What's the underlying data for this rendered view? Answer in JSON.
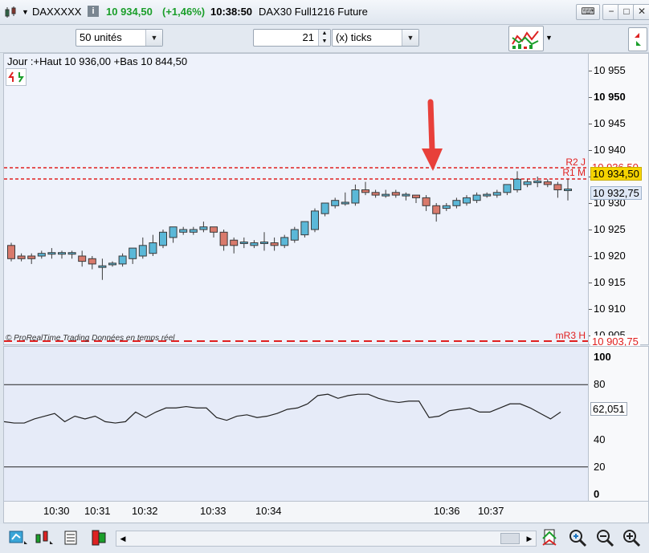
{
  "titlebar": {
    "instrument": "DAXXXXX",
    "price": "10 934,50",
    "change": "(+1,46%)",
    "time": "10:38:50",
    "description": "DAX30 Full1216 Future",
    "info_icon": "info-icon"
  },
  "toolbar": {
    "units_value": "50 unités",
    "ticks_value": "21",
    "ticks_unit": "(x) ticks"
  },
  "chart": {
    "header": "Jour :+Haut 10 936,00 +Bas 10 844,50",
    "watermark": "© ProRealTime Trading  Données en temps réel",
    "price_ticks": [
      "10 955",
      "10 950",
      "10 945",
      "10 940",
      "10 935",
      "10 930",
      "10 925",
      "10 920",
      "10 915",
      "10 910",
      "10 905"
    ],
    "levels": [
      {
        "label": "R2 J",
        "value": "10 936,50",
        "color": "#e0201f"
      },
      {
        "label": "R1 M",
        "value": "10 934,50",
        "color": "#e0201f"
      },
      {
        "label": "mR3 H",
        "value": "10 903,75",
        "color": "#e0201f"
      }
    ],
    "last_price": "10 934,50",
    "other_price": "10 932,75",
    "indicator_value": "62,051",
    "indicator_ticks": [
      "100",
      "80",
      "60",
      "40",
      "20",
      "0"
    ],
    "time_labels": [
      "10:30",
      "10:31",
      "10:32",
      "10:33",
      "10:34",
      "10:36",
      "10:37"
    ]
  },
  "chart_data": {
    "type": "candlestick",
    "ylim": [
      10902,
      10959
    ],
    "candles": [
      [
        10922.0,
        10919.5,
        10922.5,
        10919.0
      ],
      [
        10920.0,
        10919.5,
        10920.5,
        10919.0
      ],
      [
        10920.0,
        10919.5,
        10920.5,
        10918.5
      ],
      [
        10920.0,
        10920.5,
        10921.0,
        10919.5
      ],
      [
        10920.5,
        10920.5,
        10921.5,
        10919.5
      ],
      [
        10920.5,
        10920.5,
        10921.0,
        10919.5
      ],
      [
        10920.5,
        10920.5,
        10921.0,
        10919.5
      ],
      [
        10920.0,
        10919.0,
        10921.0,
        10918.0
      ],
      [
        10919.5,
        10918.5,
        10920.0,
        10917.5
      ],
      [
        10918.0,
        10918.0,
        10919.5,
        10915.5
      ],
      [
        10918.5,
        10918.5,
        10919.0,
        10918.0
      ],
      [
        10918.5,
        10920.0,
        10920.5,
        10918.0
      ],
      [
        10919.5,
        10921.5,
        10921.5,
        10918.5
      ],
      [
        10920.0,
        10922.0,
        10923.5,
        10919.5
      ],
      [
        10920.5,
        10922.5,
        10924.0,
        10920.0
      ],
      [
        10922.0,
        10924.5,
        10925.0,
        10921.5
      ],
      [
        10923.5,
        10925.5,
        10925.5,
        10922.5
      ],
      [
        10924.5,
        10925.0,
        10925.5,
        10924.0
      ],
      [
        10924.5,
        10925.0,
        10925.5,
        10924.0
      ],
      [
        10925.0,
        10925.5,
        10926.5,
        10924.5
      ],
      [
        10925.5,
        10924.5,
        10925.5,
        10923.5
      ],
      [
        10924.5,
        10922.0,
        10925.0,
        10921.0
      ],
      [
        10923.0,
        10922.0,
        10923.5,
        10920.5
      ],
      [
        10922.5,
        10922.5,
        10923.5,
        10921.5
      ],
      [
        10922.0,
        10922.5,
        10923.0,
        10921.5
      ],
      [
        10922.5,
        10922.5,
        10924.5,
        10921.0
      ],
      [
        10922.5,
        10922.0,
        10923.5,
        10921.0
      ],
      [
        10922.0,
        10923.5,
        10924.0,
        10921.5
      ],
      [
        10923.0,
        10925.0,
        10925.5,
        10922.5
      ],
      [
        10924.0,
        10926.5,
        10926.5,
        10923.5
      ],
      [
        10925.0,
        10928.5,
        10929.0,
        10924.5
      ],
      [
        10928.0,
        10930.0,
        10930.0,
        10927.5
      ],
      [
        10929.5,
        10930.5,
        10931.0,
        10929.0
      ],
      [
        10930.0,
        10930.0,
        10932.0,
        10929.5
      ],
      [
        10930.0,
        10932.5,
        10933.5,
        10929.5
      ],
      [
        10932.5,
        10932.0,
        10934.0,
        10931.5
      ],
      [
        10932.0,
        10931.5,
        10932.5,
        10931.0
      ],
      [
        10931.5,
        10931.5,
        10932.5,
        10931.0
      ],
      [
        10932.0,
        10931.5,
        10932.5,
        10931.0
      ],
      [
        10931.5,
        10931.5,
        10932.0,
        10930.5
      ],
      [
        10931.5,
        10931.0,
        10931.5,
        10930.0
      ],
      [
        10931.0,
        10929.5,
        10931.5,
        10928.5
      ],
      [
        10929.5,
        10928.0,
        10930.0,
        10926.5
      ],
      [
        10929.0,
        10929.5,
        10930.0,
        10928.5
      ],
      [
        10929.5,
        10930.5,
        10931.0,
        10929.0
      ],
      [
        10930.0,
        10931.0,
        10931.5,
        10929.5
      ],
      [
        10930.5,
        10931.5,
        10932.0,
        10930.0
      ],
      [
        10931.5,
        10931.5,
        10932.0,
        10931.0
      ],
      [
        10931.5,
        10932.0,
        10932.5,
        10931.0
      ],
      [
        10932.0,
        10933.5,
        10933.5,
        10931.5
      ],
      [
        10932.5,
        10934.5,
        10936.0,
        10932.0
      ],
      [
        10933.5,
        10934.0,
        10934.5,
        10933.0
      ],
      [
        10934.0,
        10934.0,
        10935.0,
        10933.0
      ],
      [
        10934.0,
        10933.5,
        10934.5,
        10933.0
      ],
      [
        10933.5,
        10932.5,
        10934.0,
        10931.0
      ],
      [
        10932.5,
        10932.5,
        10934.5,
        10930.5
      ]
    ],
    "indicator": [
      53,
      52,
      52,
      55,
      57,
      59,
      53,
      57,
      55,
      57,
      53,
      52,
      53,
      60,
      56,
      60,
      63,
      63,
      64,
      63,
      63,
      56,
      54,
      57,
      58,
      56,
      57,
      59,
      62,
      63,
      66,
      72,
      73,
      70,
      72,
      73,
      73,
      70,
      68,
      67,
      68,
      68,
      56,
      57,
      61,
      62,
      63,
      60,
      60,
      63,
      66,
      66,
      63,
      59,
      55,
      60
    ],
    "indicator_levels": [
      80,
      20
    ]
  },
  "bottombar": {}
}
